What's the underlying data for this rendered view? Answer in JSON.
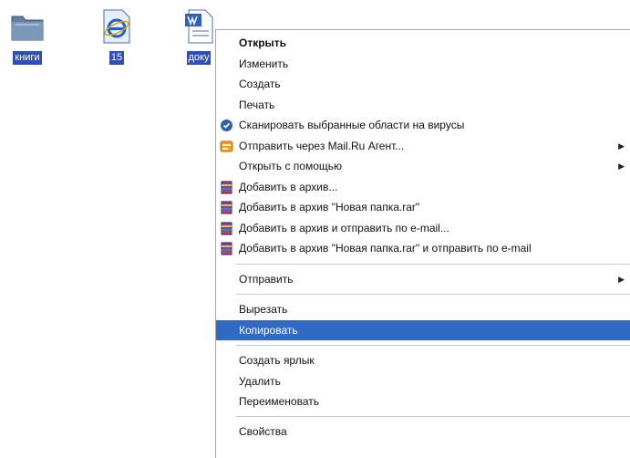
{
  "desktop": {
    "icons": [
      {
        "label": "книги",
        "icon": "folder-icon"
      },
      {
        "label": "15",
        "icon": "internet-explorer-icon"
      },
      {
        "label": "доку",
        "icon": "word-document-icon"
      }
    ]
  },
  "context_menu": {
    "items": [
      {
        "label": "Открыть",
        "bold": true
      },
      {
        "label": "Изменить"
      },
      {
        "label": "Создать"
      },
      {
        "label": "Печать"
      },
      {
        "label": "Сканировать выбранные области на вирусы",
        "icon": "antivirus-icon"
      },
      {
        "label": "Отправить через Mail.Ru Агент...",
        "icon": "mail-agent-icon",
        "submenu": true
      },
      {
        "label": "Открыть с помощью",
        "submenu": true
      },
      {
        "label": "Добавить в архив...",
        "icon": "winrar-icon"
      },
      {
        "label": "Добавить в архив \"Новая папка.rar\"",
        "icon": "winrar-icon"
      },
      {
        "label": "Добавить в архив и отправить по e-mail...",
        "icon": "winrar-icon"
      },
      {
        "label": "Добавить в архив \"Новая папка.rar\" и отправить по e-mail",
        "icon": "winrar-icon"
      },
      {
        "label": "Отправить",
        "submenu": true
      },
      {
        "label": "Вырезать"
      },
      {
        "label": "Копировать",
        "selected": true
      },
      {
        "label": "Создать ярлык"
      },
      {
        "label": "Удалить"
      },
      {
        "label": "Переименовать"
      },
      {
        "label": "Свойства"
      }
    ]
  },
  "colors": {
    "selection": "#316ac5",
    "icon_label_bg": "#2f4fb5"
  }
}
